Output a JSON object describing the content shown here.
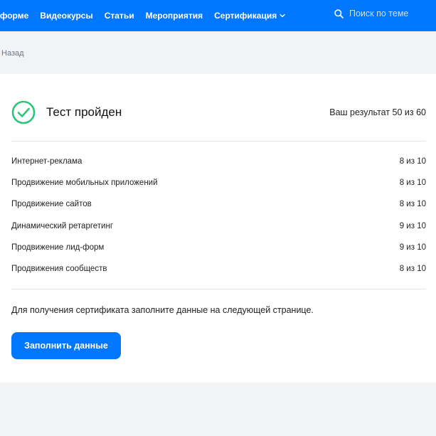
{
  "nav": {
    "items": [
      {
        "label": "тформе"
      },
      {
        "label": "Видеокурсы"
      },
      {
        "label": "Статьи"
      },
      {
        "label": "Мероприятия"
      },
      {
        "label": "Сертификация",
        "has_dropdown": true
      }
    ],
    "search_placeholder": "Поиск по теме"
  },
  "back": {
    "label": "Назад"
  },
  "result": {
    "title": "Тест пройден",
    "score": "Ваш результат 50 из 60",
    "rows": [
      {
        "topic": "Интернет-реклама",
        "score": "8 из 10"
      },
      {
        "topic": "Продвижение мобильных приложений",
        "score": "8 из 10"
      },
      {
        "topic": "Продвижение сайтов",
        "score": "8 из 10"
      },
      {
        "topic": "Динамический ретаргетинг",
        "score": "9 из 10"
      },
      {
        "topic": "Продвижение лид-форм",
        "score": "9 из 10"
      },
      {
        "topic": "Продвижения сообществ",
        "score": "8 из 10"
      }
    ],
    "note": "Для получения сертификата заполните данные на следующей странице.",
    "button_label": "Заполнить данные"
  },
  "colors": {
    "brand": "#0077ff",
    "success": "#2fc37a"
  },
  "icons": {
    "check": "check-circle-icon",
    "search": "search-icon",
    "dropdown": "chevron-down-icon"
  }
}
